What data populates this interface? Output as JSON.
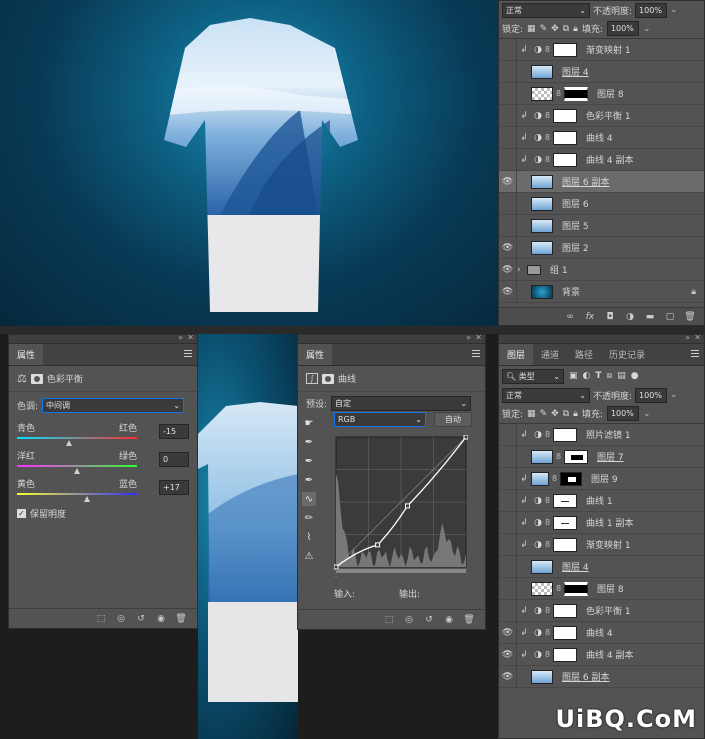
{
  "colors": {
    "accent": "#1473e6",
    "panel": "#535353"
  },
  "top_layers": {
    "blend": "正常",
    "opacity_label": "不透明度:",
    "opacity": "100%",
    "lock_label": "锁定:",
    "fill_label": "填充:",
    "fill": "100%",
    "rows": [
      {
        "name": "渐变映射 1",
        "visible": false,
        "clip": true,
        "type": "adj",
        "underline": false,
        "selected": false
      },
      {
        "name": "图层 4",
        "visible": false,
        "clip": false,
        "type": "img",
        "underline": true,
        "selected": false
      },
      {
        "name": "图层 8",
        "visible": false,
        "clip": false,
        "type": "mask",
        "underline": false,
        "selected": false
      },
      {
        "name": "色彩平衡 1",
        "visible": false,
        "clip": true,
        "type": "adj",
        "underline": false,
        "selected": false
      },
      {
        "name": "曲线 4",
        "visible": false,
        "clip": true,
        "type": "adj",
        "underline": false,
        "selected": false
      },
      {
        "name": "曲线 4 副本",
        "visible": false,
        "clip": true,
        "type": "adj",
        "underline": false,
        "selected": false
      },
      {
        "name": "图层 6 副本",
        "visible": true,
        "clip": false,
        "type": "img",
        "underline": true,
        "selected": true
      },
      {
        "name": "图层 6",
        "visible": false,
        "clip": false,
        "type": "img",
        "underline": false,
        "selected": false
      },
      {
        "name": "图层 5",
        "visible": false,
        "clip": false,
        "type": "img",
        "underline": false,
        "selected": false
      },
      {
        "name": "图层 2",
        "visible": true,
        "clip": false,
        "type": "img",
        "underline": false,
        "selected": false
      },
      {
        "name": "组 1",
        "visible": true,
        "clip": false,
        "type": "group",
        "underline": false,
        "selected": false
      },
      {
        "name": "背景",
        "visible": true,
        "clip": false,
        "type": "bg",
        "underline": false,
        "selected": false
      }
    ]
  },
  "props_color": {
    "tab": "属性",
    "title": "色彩平衡",
    "tone_label": "色调:",
    "tone": "中间调",
    "sliders": [
      {
        "left": "青色",
        "right": "红色",
        "value": "-15",
        "pos": 0.43,
        "grad": "linear-gradient(90deg,#00e5ff,#ff2d2d)"
      },
      {
        "left": "洋红",
        "right": "绿色",
        "value": "0",
        "pos": 0.5,
        "grad": "linear-gradient(90deg,#ff2dff,#2dff2d)"
      },
      {
        "left": "黄色",
        "right": "蓝色",
        "value": "+17",
        "pos": 0.58,
        "grad": "linear-gradient(90deg,#ffff2d,#2d2dff)"
      }
    ],
    "preserve": "保留明度"
  },
  "props_curves": {
    "tab": "属性",
    "title": "曲线",
    "preset_label": "预设:",
    "preset": "自定",
    "channel": "RGB",
    "auto": "自动",
    "input_label": "输入:",
    "output_label": "输出:",
    "points": [
      [
        0,
        0
      ],
      [
        0.32,
        0.17
      ],
      [
        0.55,
        0.47
      ],
      [
        1,
        1
      ]
    ]
  },
  "bottom_layers": {
    "tabs": [
      "图层",
      "通道",
      "路径",
      "历史记录"
    ],
    "filter": "类型",
    "blend": "正常",
    "opacity_label": "不透明度:",
    "opacity": "100%",
    "lock_label": "锁定:",
    "fill_label": "填充:",
    "fill": "100%",
    "rows": [
      {
        "name": "照片滤镜 1",
        "visible": false,
        "clip": true,
        "type": "adj",
        "underline": false
      },
      {
        "name": "图层 7",
        "visible": false,
        "clip": false,
        "type": "mask2",
        "underline": true
      },
      {
        "name": "图层 9",
        "visible": false,
        "clip": true,
        "type": "mask3",
        "underline": false
      },
      {
        "name": "曲线 1",
        "visible": false,
        "clip": true,
        "type": "adjline",
        "underline": false
      },
      {
        "name": "曲线 1 副本",
        "visible": false,
        "clip": true,
        "type": "adjline",
        "underline": false
      },
      {
        "name": "渐变映射 1",
        "visible": false,
        "clip": true,
        "type": "adj",
        "underline": false
      },
      {
        "name": "图层 4",
        "visible": false,
        "clip": false,
        "type": "img",
        "underline": true
      },
      {
        "name": "图层 8",
        "visible": false,
        "clip": false,
        "type": "mask",
        "underline": false
      },
      {
        "name": "色彩平衡 1",
        "visible": false,
        "clip": true,
        "type": "adj",
        "underline": false
      },
      {
        "name": "曲线 4",
        "visible": true,
        "clip": true,
        "type": "adj",
        "underline": false
      },
      {
        "name": "曲线 4 副本",
        "visible": true,
        "clip": true,
        "type": "adj",
        "underline": false
      },
      {
        "name": "图层 6 副本",
        "visible": true,
        "clip": false,
        "type": "img",
        "underline": true
      }
    ]
  },
  "watermark": "UiBQ.CoM"
}
